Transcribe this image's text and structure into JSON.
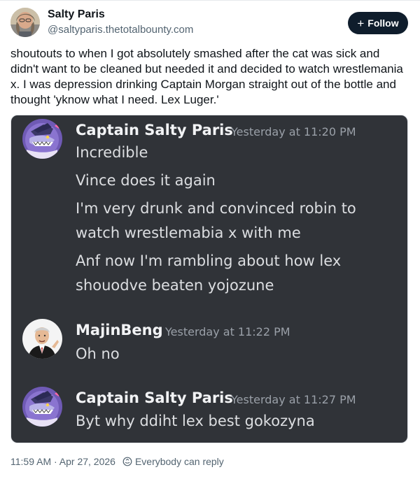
{
  "post": {
    "author_name": "Salty Paris",
    "author_handle": "@saltyparis.thetotalbounty.com",
    "follow_label": "Follow",
    "follow_icon": "+",
    "text": "shoutouts to when I got absolutely smashed after the cat was sick and didn't want to be cleaned but needed it and decided to watch wrestlemania x. I was depression drinking Captain Morgan straight out of the bottle and thought 'yknow what I need. Lex Luger.'",
    "timestamp": "11:59 AM · Apr 27, 2026",
    "reply_setting": "Everybody can reply"
  },
  "screenshot": {
    "messages": [
      {
        "author": "Captain Salty Paris",
        "time": "Yesterday at 11:20 PM",
        "lines": [
          "Incredible",
          "Vince does it again",
          "I'm very drunk and convinced robin to",
          "watch wrestlemabia x with me",
          "Anf now I'm rambling about how lex",
          "shouodve beaten yojozune"
        ]
      },
      {
        "author": "MajinBeng",
        "time": "Yesterday at 11:22 PM",
        "lines": [
          "Oh no"
        ]
      },
      {
        "author": "Captain Salty Paris",
        "time": "Yesterday at 11:27 PM",
        "lines": [
          "Byt why ddiht lex best gokozyna"
        ]
      }
    ]
  },
  "colors": {
    "follow_bg": "#0f1d2c",
    "discord_bg": "#303338",
    "discord_name": "#f2f3f5",
    "discord_time": "#9aa0a8",
    "discord_text": "#dcdee1"
  },
  "icons": {
    "reply": "globe-reply-icon"
  }
}
